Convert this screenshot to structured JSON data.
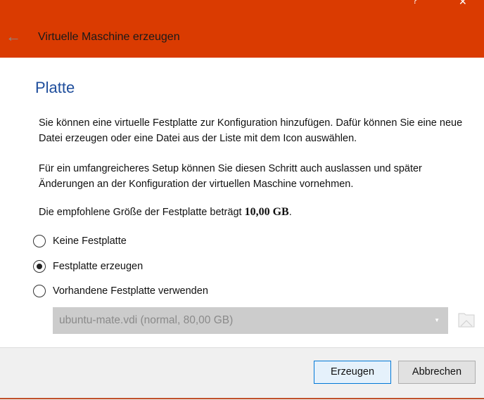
{
  "window": {
    "help_icon": "?",
    "close_icon": "✕",
    "title": "Virtuelle Maschine erzeugen",
    "accent": "#DA3B01"
  },
  "page": {
    "heading": "Platte",
    "para1": "Sie können eine virtuelle Festplatte zur Konfiguration hinzufügen. Dafür können Sie eine neue Datei erzeugen oder eine Datei aus der Liste mit dem Icon auswählen.",
    "para2": "Für ein umfangreicheres Setup können Sie diesen Schritt auch auslassen und später Änderungen an der Konfiguration der virtuellen Maschine vornehmen.",
    "para3_prefix": "Die empfohlene Größe der Festplatte beträgt ",
    "para3_size": "10,00 GB",
    "para3_suffix": "."
  },
  "options": [
    {
      "label": "Keine Festplatte",
      "selected": false
    },
    {
      "label": "Festplatte erzeugen",
      "selected": true
    },
    {
      "label": "Vorhandene Festplatte verwenden",
      "selected": false
    }
  ],
  "disk_select": {
    "value": "ubuntu-mate.vdi (normal, 80,00 GB)",
    "arrow": "▼"
  },
  "buttons": {
    "create": "Erzeugen",
    "cancel": "Abbrechen"
  }
}
